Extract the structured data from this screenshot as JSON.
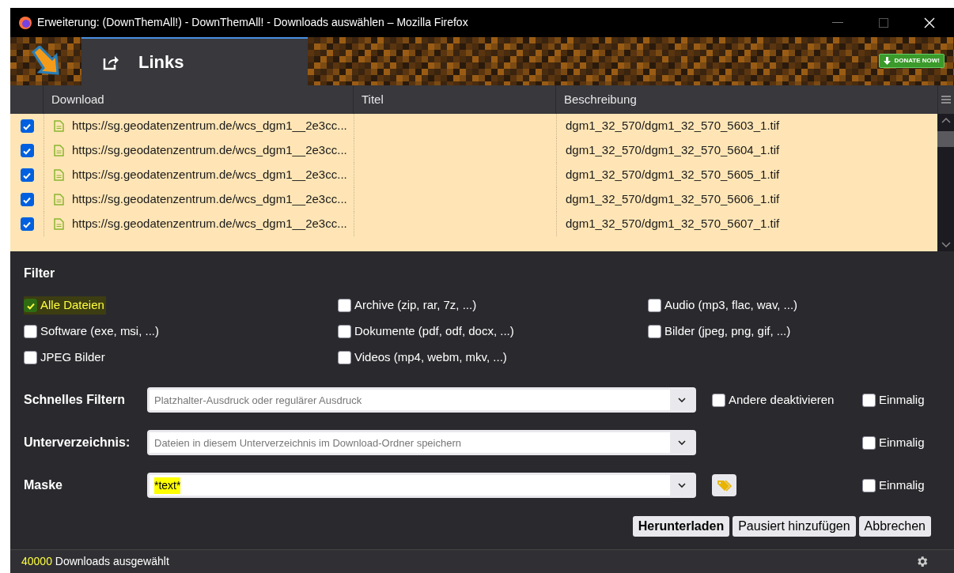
{
  "window": {
    "title": "Erweiterung: (DownThemAll!) - DownThemAll! - Downloads auswählen – Mozilla Firefox"
  },
  "header": {
    "tab": {
      "label": "Links",
      "selected": true
    },
    "donate": "DONATE NOW!"
  },
  "table": {
    "columns": [
      "Download",
      "Titel",
      "Beschreibung"
    ],
    "rows": [
      {
        "checked": true,
        "download": "https://sg.geodatenzentrum.de/wcs_dgm1__2e3cc...",
        "description": "dgm1_32_570/dgm1_32_570_5603_1.tif"
      },
      {
        "checked": true,
        "download": "https://sg.geodatenzentrum.de/wcs_dgm1__2e3cc...",
        "description": "dgm1_32_570/dgm1_32_570_5604_1.tif"
      },
      {
        "checked": true,
        "download": "https://sg.geodatenzentrum.de/wcs_dgm1__2e3cc...",
        "description": "dgm1_32_570/dgm1_32_570_5605_1.tif"
      },
      {
        "checked": true,
        "download": "https://sg.geodatenzentrum.de/wcs_dgm1__2e3cc...",
        "description": "dgm1_32_570/dgm1_32_570_5606_1.tif"
      },
      {
        "checked": true,
        "download": "https://sg.geodatenzentrum.de/wcs_dgm1__2e3cc...",
        "description": "dgm1_32_570/dgm1_32_570_5607_1.tif"
      }
    ]
  },
  "filter": {
    "title": "Filter",
    "items": [
      {
        "label": "Alle Dateien",
        "checked": true,
        "highlighted": true
      },
      {
        "label": "Archive (zip, rar, 7z, ...)",
        "checked": false,
        "highlighted": false
      },
      {
        "label": "Audio (mp3, flac, wav, ...)",
        "checked": false,
        "highlighted": false
      },
      {
        "label": "Software (exe, msi, ...)",
        "checked": false,
        "highlighted": false
      },
      {
        "label": "Dokumente (pdf, odf, docx, ...)",
        "checked": false,
        "highlighted": false
      },
      {
        "label": "Bilder (jpeg, png, gif, ...)",
        "checked": false,
        "highlighted": false
      },
      {
        "label": "JPEG Bilder",
        "checked": false,
        "highlighted": false
      },
      {
        "label": "Videos (mp4, webm, mkv, ...)",
        "checked": false,
        "highlighted": false
      }
    ]
  },
  "fields": [
    {
      "label": "Schnelles Filtern",
      "placeholder": "Platzhalter-Ausdruck oder regulärer Ausdruck",
      "extra": {
        "kind": "checkbox",
        "label": "Andere deaktivieren",
        "checked": false
      },
      "once": {
        "label": "Einmalig",
        "checked": false
      }
    },
    {
      "label": "Unterverzeichnis:",
      "placeholder": "Dateien in diesem Unterverzeichnis im Download-Ordner speichern",
      "once": {
        "label": "Einmalig",
        "checked": false
      }
    },
    {
      "label": "Maske",
      "value": "*text*",
      "highlighted": true,
      "extra": {
        "kind": "tag-button"
      },
      "once": {
        "label": "Einmalig",
        "checked": false
      }
    }
  ],
  "buttons": [
    {
      "label": "Herunterladen",
      "primary": true
    },
    {
      "label": "Pausiert hinzufügen",
      "primary": false
    },
    {
      "label": "Abbrechen",
      "primary": false
    }
  ],
  "status": {
    "count": "40000",
    "count_highlighted": true,
    "text": "Downloads ausgewählt"
  }
}
